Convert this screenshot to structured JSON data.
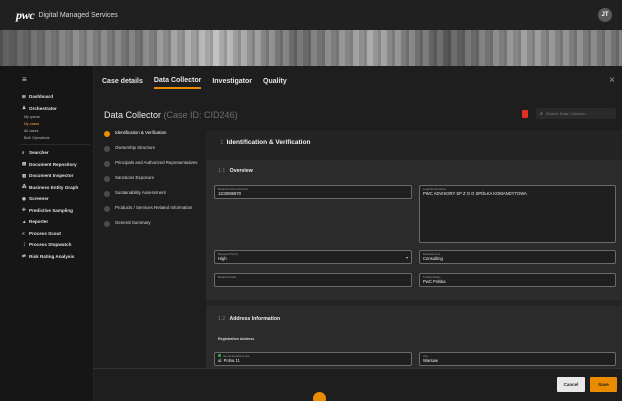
{
  "brand": {
    "logo": "pwc",
    "title": "Digital Managed Services",
    "avatar_initials": "JT"
  },
  "sidebar": {
    "menu_icon": "≡",
    "items": [
      {
        "icon": "⊞",
        "label": "Dashboard"
      },
      {
        "icon": "♟",
        "label": "Orchestrator"
      }
    ],
    "sub_items": [
      {
        "label": "My queue",
        "active": false
      },
      {
        "label": "My cases",
        "active": true
      },
      {
        "label": "All cases",
        "active": false
      },
      {
        "label": "Bulk Operations",
        "active": false
      }
    ],
    "items2": [
      {
        "icon": "⌕",
        "label": "Searcher"
      },
      {
        "icon": "▤",
        "label": "Document Repository"
      },
      {
        "icon": "▥",
        "label": "Document Inspector"
      },
      {
        "icon": "⁂",
        "label": "Business Entity Graph"
      },
      {
        "icon": "◉",
        "label": "Screener"
      },
      {
        "icon": "✣",
        "label": "Predictive Sampling"
      },
      {
        "icon": "▲",
        "label": "Reporter"
      },
      {
        "icon": "<",
        "label": "Process Scout"
      },
      {
        "icon": "⋮",
        "label": "Process Stopwatch"
      },
      {
        "icon": "⇄",
        "label": "Risk Rating Analysis"
      }
    ]
  },
  "tabs": [
    {
      "label": "Case details",
      "active": false
    },
    {
      "label": "Data Collector",
      "active": true
    },
    {
      "label": "Investigator",
      "active": false
    },
    {
      "label": "Quality",
      "active": false
    }
  ],
  "close_icon": "×",
  "collector": {
    "title": "Data Collector",
    "case_label": "(Case ID: CID246)",
    "search_placeholder": "Search Data Collector..."
  },
  "steps": [
    {
      "label": "Identification & Verification",
      "active": true
    },
    {
      "label": "Ownership Structure",
      "active": false
    },
    {
      "label": "Principals and Authorized Representatives",
      "active": false
    },
    {
      "label": "Sanctions Exposure",
      "active": false
    },
    {
      "label": "Sustainability Assessment",
      "active": false
    },
    {
      "label": "Products / Services Related Information",
      "active": false
    },
    {
      "label": "General Summary",
      "active": false
    }
  ],
  "content": {
    "section_index": "1",
    "section_title": "Identification & Verification",
    "overview": {
      "index": "1.1",
      "title": "Overview",
      "fields": {
        "client_number": {
          "label": "Business Client Number",
          "value": "1103086970"
        },
        "legal_name": {
          "label": "Legal Entity Name",
          "value": "PWC ADVISORY SP Z O O SPÓŁKA KOMANDYTOWA"
        },
        "priority": {
          "label": "Request Priority",
          "value": "High"
        },
        "business_line": {
          "label": "Business Line",
          "value": "Consulting"
        },
        "business_field": {
          "label": "Business Field",
          "value": ""
        },
        "trading_name": {
          "label": "Trading Name",
          "value": "PwC Polska"
        }
      }
    },
    "address": {
      "index": "1.2",
      "title": "Address Information",
      "sub_label": "Registration Address",
      "fields": {
        "street": {
          "label": "Ga ulica/Address line",
          "value": "ul. Polna 11"
        },
        "city": {
          "label": "City",
          "value": "Warsaw"
        }
      }
    }
  },
  "footer": {
    "cancel_label": "Cancel",
    "save_label": "Save"
  },
  "colors": {
    "accent": "#eb8c00",
    "background": "#1c1c1c",
    "doc_icon": "#e0301e"
  }
}
